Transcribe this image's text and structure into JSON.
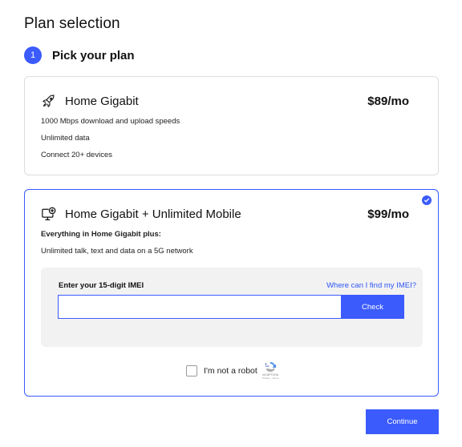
{
  "page": {
    "title": "Plan selection"
  },
  "step": {
    "number": "1",
    "label": "Pick your plan"
  },
  "plans": [
    {
      "name": "Home Gigabit",
      "price": "$89/mo",
      "icon": "rocket-icon",
      "features": [
        "1000 Mbps download and upload speeds",
        "Unlimited data",
        "Connect 20+ devices"
      ],
      "selected": false
    },
    {
      "name": "Home Gigabit + Unlimited Mobile",
      "price": "$99/mo",
      "icon": "monitor-plus-icon",
      "subtitle": "Everything in Home Gigabit plus:",
      "features": [
        "Unlimited talk, text and data on a 5G network"
      ],
      "selected": true
    }
  ],
  "imei": {
    "label": "Enter your 15-digit IMEI",
    "help_link": "Where can I find my IMEI?",
    "value": "",
    "check_label": "Check"
  },
  "captcha": {
    "label": "I'm not a robot",
    "brand": "reCAPTCHA",
    "terms": "Privacy - Terms",
    "checked": false
  },
  "continue_label": "Continue",
  "colors": {
    "accent": "#3b5bfd",
    "link": "#2f56f5",
    "card_border": "#dcdde0",
    "panel_bg": "#f2f2f3"
  }
}
